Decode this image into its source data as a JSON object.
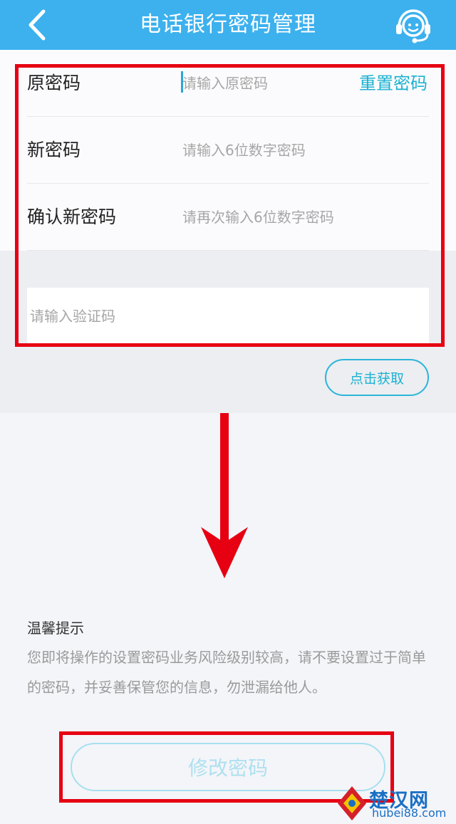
{
  "header": {
    "title": "电话银行密码管理",
    "back_icon": "chevron-left-icon",
    "service_icon": "customer-service-icon",
    "bg_color": "#3cb1ee"
  },
  "form": {
    "old_password": {
      "label": "原密码",
      "placeholder": "请输入原密码",
      "reset_link": "重置密码"
    },
    "new_password": {
      "label": "新密码",
      "placeholder": "请输入6位数字密码"
    },
    "confirm_password": {
      "label": "确认新密码",
      "placeholder": "请再次输入6位数字密码"
    }
  },
  "verification": {
    "placeholder": "请输入验证码",
    "get_code_label": "点击获取"
  },
  "tips": {
    "title": "温馨提示",
    "text": "您即将操作的设置密码业务风险级别较高，请不要设置过于简单的密码，并妥善保管您的信息，勿泄漏给他人。"
  },
  "submit": {
    "label": "修改密码"
  },
  "watermark": {
    "name": "楚汉网",
    "url": "hubei88.com"
  },
  "colors": {
    "accent": "#1bb1d1",
    "annotation": "#e60012"
  }
}
